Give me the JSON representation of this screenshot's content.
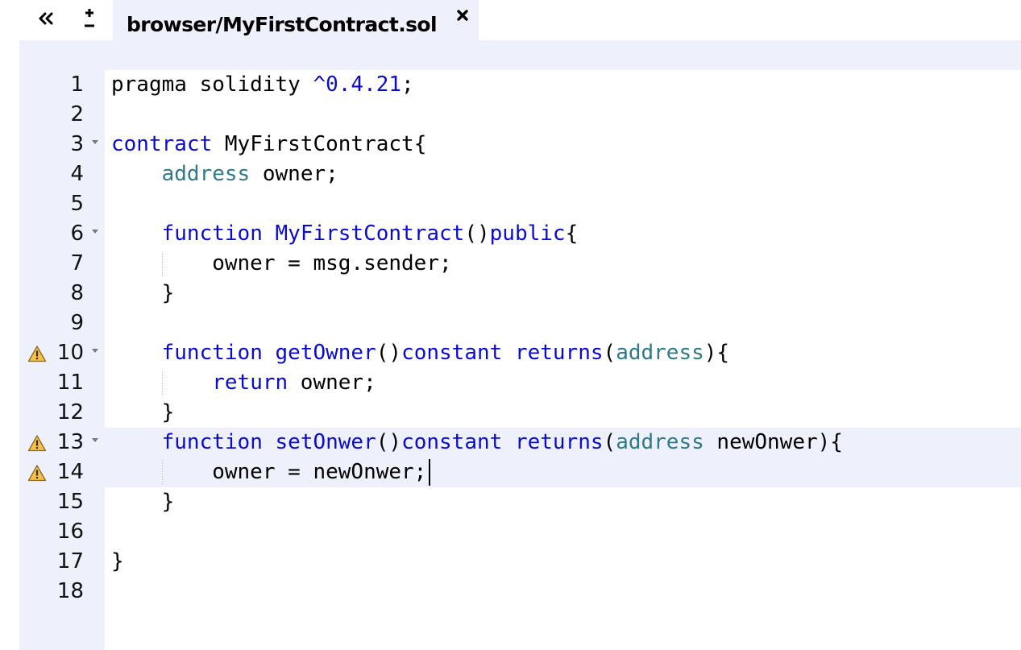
{
  "toolbar": {
    "collapse_glyph": "«",
    "zoom_plus": "+",
    "zoom_minus": "−"
  },
  "tab": {
    "title": "browser/MyFirstContract.sol",
    "close_glyph": "✖"
  },
  "editor": {
    "active_line": 13,
    "cursor_line": 14,
    "lines": [
      {
        "number": "1",
        "fold": false,
        "warning": false,
        "tokens": [
          {
            "text": "pragma solidity ",
            "type": "plain"
          },
          {
            "text": "^0.4.21",
            "type": "number"
          },
          {
            "text": ";",
            "type": "plain"
          }
        ]
      },
      {
        "number": "2",
        "fold": false,
        "warning": false,
        "tokens": []
      },
      {
        "number": "3",
        "fold": true,
        "warning": false,
        "tokens": [
          {
            "text": "contract",
            "type": "keyword"
          },
          {
            "text": " MyFirstContract{",
            "type": "plain"
          }
        ]
      },
      {
        "number": "4",
        "fold": false,
        "warning": false,
        "tokens": [
          {
            "text": "    ",
            "type": "plain"
          },
          {
            "text": "address",
            "type": "type"
          },
          {
            "text": " owner;",
            "type": "plain"
          }
        ]
      },
      {
        "number": "5",
        "fold": false,
        "warning": false,
        "tokens": []
      },
      {
        "number": "6",
        "fold": true,
        "warning": false,
        "tokens": [
          {
            "text": "    ",
            "type": "plain"
          },
          {
            "text": "function",
            "type": "keyword"
          },
          {
            "text": " ",
            "type": "plain"
          },
          {
            "text": "MyFirstContract",
            "type": "keyword"
          },
          {
            "text": "()",
            "type": "plain"
          },
          {
            "text": "public",
            "type": "keyword"
          },
          {
            "text": "{",
            "type": "plain"
          }
        ]
      },
      {
        "number": "7",
        "fold": false,
        "warning": false,
        "tokens": [
          {
            "text": "        owner = msg.sender;",
            "type": "plain"
          }
        ]
      },
      {
        "number": "8",
        "fold": false,
        "warning": false,
        "tokens": [
          {
            "text": "    }",
            "type": "plain"
          }
        ]
      },
      {
        "number": "9",
        "fold": false,
        "warning": false,
        "tokens": []
      },
      {
        "number": "10",
        "fold": true,
        "warning": true,
        "tokens": [
          {
            "text": "    ",
            "type": "plain"
          },
          {
            "text": "function",
            "type": "keyword"
          },
          {
            "text": " ",
            "type": "plain"
          },
          {
            "text": "getOwner",
            "type": "keyword"
          },
          {
            "text": "()",
            "type": "plain"
          },
          {
            "text": "constant",
            "type": "keyword"
          },
          {
            "text": " ",
            "type": "plain"
          },
          {
            "text": "returns",
            "type": "keyword"
          },
          {
            "text": "(",
            "type": "plain"
          },
          {
            "text": "address",
            "type": "type"
          },
          {
            "text": "){",
            "type": "plain"
          }
        ]
      },
      {
        "number": "11",
        "fold": false,
        "warning": false,
        "tokens": [
          {
            "text": "        ",
            "type": "plain"
          },
          {
            "text": "return",
            "type": "keyword"
          },
          {
            "text": " owner;",
            "type": "plain"
          }
        ]
      },
      {
        "number": "12",
        "fold": false,
        "warning": false,
        "tokens": [
          {
            "text": "    }",
            "type": "plain"
          }
        ]
      },
      {
        "number": "13",
        "fold": true,
        "warning": true,
        "tokens": [
          {
            "text": "    ",
            "type": "plain"
          },
          {
            "text": "function",
            "type": "keyword"
          },
          {
            "text": " ",
            "type": "plain"
          },
          {
            "text": "setOnwer",
            "type": "keyword"
          },
          {
            "text": "()",
            "type": "plain"
          },
          {
            "text": "constant",
            "type": "keyword"
          },
          {
            "text": " ",
            "type": "plain"
          },
          {
            "text": "returns",
            "type": "keyword"
          },
          {
            "text": "(",
            "type": "plain"
          },
          {
            "text": "address",
            "type": "type"
          },
          {
            "text": " newOnwer){",
            "type": "plain"
          }
        ]
      },
      {
        "number": "14",
        "fold": false,
        "warning": true,
        "tokens": [
          {
            "text": "        owner = newOnwer;",
            "type": "plain"
          }
        ]
      },
      {
        "number": "15",
        "fold": false,
        "warning": false,
        "tokens": [
          {
            "text": "    }",
            "type": "plain"
          }
        ]
      },
      {
        "number": "16",
        "fold": false,
        "warning": false,
        "tokens": []
      },
      {
        "number": "17",
        "fold": false,
        "warning": false,
        "tokens": [
          {
            "text": "}",
            "type": "plain"
          }
        ]
      },
      {
        "number": "18",
        "fold": false,
        "warning": false,
        "tokens": []
      }
    ]
  }
}
